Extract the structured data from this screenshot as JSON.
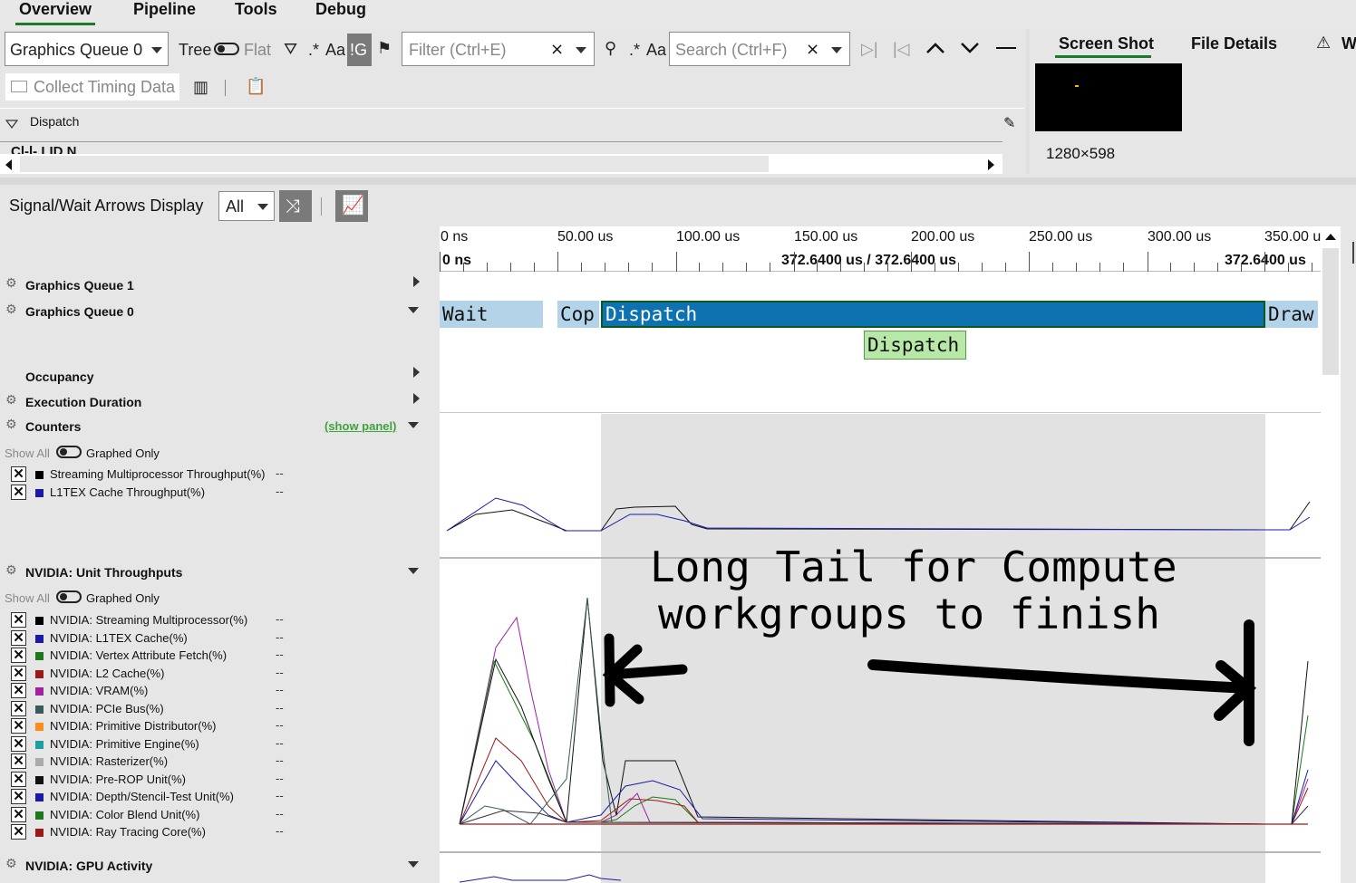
{
  "menu": {
    "items": [
      "Overview",
      "Pipeline",
      "Tools",
      "Debug"
    ]
  },
  "toolbar": {
    "queue_select": "Graphics Queue 0",
    "tree_label": "Tree",
    "flat_label": "Flat",
    "regex_label": ".*",
    "case_label": "Aa",
    "ig_label": "!G",
    "filter_placeholder": "Filter (Ctrl+E)",
    "search_regex": ".*",
    "search_case": "Aa",
    "search_placeholder": "Search (Ctrl+F)",
    "collect_timing": "Collect Timing Data"
  },
  "tree_panel": {
    "dispatch_label": "Dispatch",
    "col_partial": "Cl-l- LID  N"
  },
  "right_panel": {
    "tabs": [
      "Screen Shot",
      "File Details",
      "W"
    ],
    "resolution": "1280×598"
  },
  "timeline": {
    "signal_label": "Signal/Wait Arrows Display",
    "signal_select": "All",
    "ruler_labels": [
      "0 ns",
      "50.00 us",
      "100.00 us",
      "150.00 us",
      "200.00 us",
      "250.00 us",
      "300.00 us",
      "350.00 u"
    ],
    "ruler_start": "0 ns",
    "ruler_mid": "372.6400 us / 372.6400 us",
    "ruler_end": "372.6400 us",
    "segments": [
      "Wait",
      "Cop",
      "Dispatch",
      "Draw"
    ],
    "sub_segment": "Dispatch"
  },
  "rows": {
    "gq1": "Graphics Queue 1",
    "gq0": "Graphics Queue 0",
    "occupancy": "Occupancy",
    "exec_duration": "Execution Duration",
    "counters": "Counters",
    "show_panel": "(show panel)",
    "show_all": "Show All",
    "graphed_only": "Graphed Only",
    "unit_throughputs": "NVIDIA: Unit Throughputs",
    "show_all_2": "Show All",
    "graphed_only_2": "Graphed Only",
    "gpu_activity": "NVIDIA: GPU Activity"
  },
  "counters": [
    {
      "name": "Streaming Multiprocessor Throughput(%)",
      "value": "--",
      "color": "#000000"
    },
    {
      "name": "L1TEX Cache Throughput(%)",
      "value": "--",
      "color": "#1a1aa6"
    }
  ],
  "unit_counters": [
    {
      "name": "NVIDIA: Streaming Multiprocessor(%)",
      "value": "--",
      "color": "#000000"
    },
    {
      "name": "NVIDIA: L1TEX Cache(%)",
      "value": "--",
      "color": "#1a1aa6"
    },
    {
      "name": "NVIDIA: Vertex Attribute Fetch(%)",
      "value": "--",
      "color": "#1a7a1a"
    },
    {
      "name": "NVIDIA: L2 Cache(%)",
      "value": "--",
      "color": "#9a1a1a"
    },
    {
      "name": "NVIDIA: VRAM(%)",
      "value": "--",
      "color": "#a020a0"
    },
    {
      "name": "NVIDIA: PCIe Bus(%)",
      "value": "--",
      "color": "#3a5a5a"
    },
    {
      "name": "NVIDIA: Primitive Distributor(%)",
      "value": "--",
      "color": "#ff8c1a"
    },
    {
      "name": "NVIDIA: Primitive Engine(%)",
      "value": "--",
      "color": "#1aa0a0"
    },
    {
      "name": "NVIDIA: Rasterizer(%)",
      "value": "--",
      "color": "#aaaaaa"
    },
    {
      "name": "NVIDIA: Pre-ROP Unit(%)",
      "value": "--",
      "color": "#111111"
    },
    {
      "name": "NVIDIA: Depth/Stencil-Test Unit(%)",
      "value": "--",
      "color": "#1a1aa6"
    },
    {
      "name": "NVIDIA: Color Blend Unit(%)",
      "value": "--",
      "color": "#1a7a1a"
    },
    {
      "name": "NVIDIA: Ray Tracing Core(%)",
      "value": "--",
      "color": "#9a1a1a"
    }
  ],
  "annotation": {
    "line1": "Long Tail for Compute",
    "line2": "workgroups to finish"
  }
}
